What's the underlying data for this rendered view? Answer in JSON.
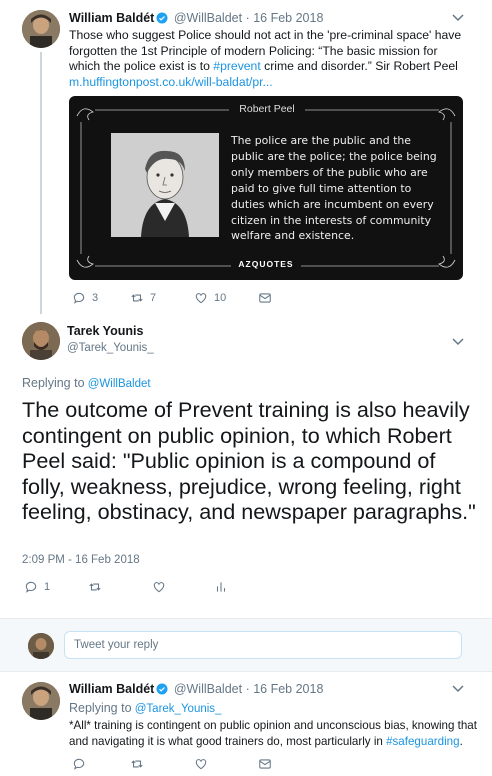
{
  "tweet1": {
    "author_name": "William Baldét",
    "author_handle": "@WillBaldet",
    "separator": "·",
    "date": "16 Feb 2018",
    "text_before_tag": "Those who suggest Police should not act in the 'pre-criminal space' have forgotten the 1st Principle of modern Policing: “The basic mission for which the police exist is to ",
    "hashtag": "#prevent",
    "text_after_tag": " crime and disorder.” Sir Robert Peel",
    "url": "m.huffingtonpost.co.uk/will-baldat/pr...",
    "quote_card": {
      "author": "Robert Peel",
      "quote": "The police are the public and the public are the police; the police being only members of the public who are paid to give full time attention to duties which are incumbent on every citizen in the interests of community welfare and existence.",
      "brand": "AZQUOTES"
    },
    "replies": "3",
    "retweets": "7",
    "likes": "10"
  },
  "tweet2": {
    "author_name": "Tarek Younis",
    "author_handle": "@Tarek_Younis_",
    "replying_to_label": "Replying to",
    "replying_to_handle": "@WillBaldet",
    "text": "The outcome of Prevent training is also heavily contingent on public opinion, to which Robert Peel said: \"Public opinion is a compound of folly, weakness, prejudice, wrong feeling, right feeling, obstinacy, and newspaper paragraphs.\"",
    "timestamp": "2:09 PM - 16 Feb 2018",
    "replies": "1"
  },
  "reply_box": {
    "placeholder": "Tweet your reply"
  },
  "tweet3": {
    "author_name": "William Baldét",
    "author_handle": "@WillBaldet",
    "separator": "·",
    "date": "16 Feb 2018",
    "replying_to_label": "Replying to",
    "replying_to_handle": "@Tarek_Younis_",
    "text_before_tag": "*All* training is contingent on public opinion and unconscious bias, knowing that and navigating it is what good trainers do, most particularly in ",
    "hashtag": "#safeguarding",
    "text_after_tag": "."
  },
  "colors": {
    "link": "#1b95e0",
    "secondary_text": "#657786",
    "divider": "#e6ecf0",
    "verified": "#1da1f2"
  },
  "icons": [
    "reply-icon",
    "retweet-icon",
    "like-icon",
    "message-icon",
    "analytics-icon",
    "chevron-down-icon",
    "verified-badge-icon"
  ]
}
